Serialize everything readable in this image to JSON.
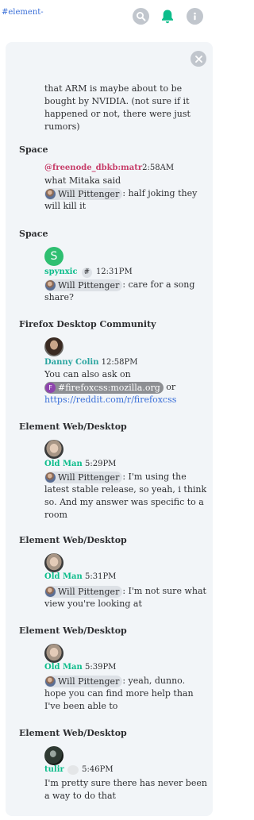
{
  "header": {
    "room_link": "#element-"
  },
  "colors": {
    "accent": "#0dbd8b",
    "link": "#3a6fd8",
    "panel": "#f2f5f8",
    "pill": "#dde1e6"
  },
  "results": {
    "r0": {
      "text": "that ARM is maybe about to be bought by NVIDIA. (not sure if it happened or not, there were just rumors)"
    },
    "r1": {
      "room": "Space",
      "sender": "@freenode_dbkb:matr",
      "time": "2:58AM",
      "line1": "what Mitaka said",
      "pill": "Will Pittenger",
      "rest": ": half joking they will kill it"
    },
    "r2": {
      "room": "Space",
      "avatar_letter": "S",
      "sender": "spynxic",
      "badge": "#",
      "time": "12:31PM",
      "pill": "Will Pittenger",
      "rest": ": care for a song share?"
    },
    "r3": {
      "room": "Firefox Desktop Community",
      "sender": "Danny Colin",
      "time": "12:58PM",
      "line1": "You can also ask on",
      "pill_letter": "F",
      "pill": "#firefoxcss:mozilla.org",
      "or": "or",
      "link": "https://reddit.com/r/firefoxcss"
    },
    "r4": {
      "room": "Element Web/Desktop",
      "sender": "Old Man",
      "time": "5:29PM",
      "pill": "Will Pittenger",
      "rest": ": I'm using the latest stable release, so yeah, i think so. And my answer was specific to a room"
    },
    "r5": {
      "room": "Element Web/Desktop",
      "sender": "Old Man",
      "time": "5:31PM",
      "pill": "Will Pittenger",
      "rest": ": I'm not sure what view you're looking at"
    },
    "r6": {
      "room": "Element Web/Desktop",
      "sender": "Old Man",
      "time": "5:39PM",
      "pill": "Will Pittenger",
      "rest": ": yeah, dunno. hope you can find more help than I've been able to"
    },
    "r7": {
      "room": "Element Web/Desktop",
      "sender": "tulir",
      "time": "5:46PM",
      "text": "I'm pretty sure there has never been a way to do that"
    }
  }
}
